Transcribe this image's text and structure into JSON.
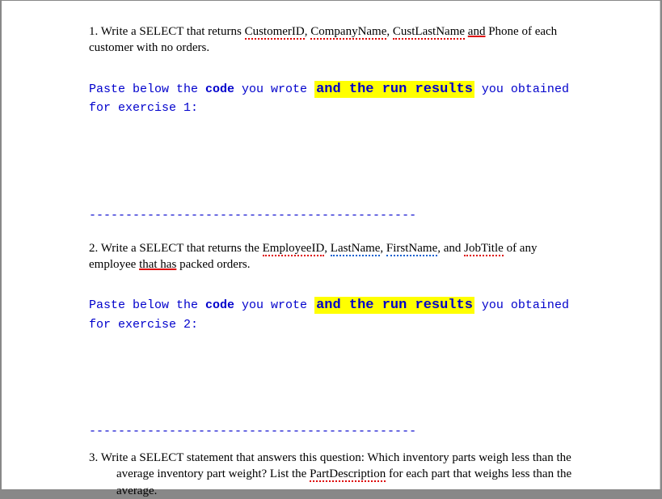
{
  "ex1": {
    "num": "1. Write a SELECT that returns ",
    "w1": "CustomerID",
    "c1": ", ",
    "w2": "CompanyName",
    "c2": ", ",
    "w3": "CustLastName",
    "c3": " ",
    "w4": "and",
    "rest": " Phone of each customer with no orders."
  },
  "paste1": {
    "a": "Paste below the ",
    "b": "code",
    "c": " you wrote ",
    "d": "and the run results",
    "e": " you obtained for exercise 1:"
  },
  "sep": "---------------------------------------------",
  "ex2": {
    "num": "2. Write a SELECT that returns the ",
    "w1": "EmployeeID",
    "c1": ", ",
    "w2": "LastName",
    "c2": ", ",
    "w3": "FirstName",
    "c3": ", and ",
    "w4": "JobTitle",
    "rest1": " of any employee ",
    "w5": "that has",
    "rest2": " packed orders."
  },
  "paste2": {
    "a": "Paste below the ",
    "b": "code",
    "c": " you wrote ",
    "d": "and the run results",
    "e": " you obtained for exercise 2:"
  },
  "ex3": {
    "line1": "3. Write a SELECT statement that answers this question: Which inventory parts weigh less than the",
    "line2a": "average inventory part weight?   List the ",
    "w1": "PartDescription",
    "line2b": " for each part that weighs less than the",
    "line3": "average."
  }
}
